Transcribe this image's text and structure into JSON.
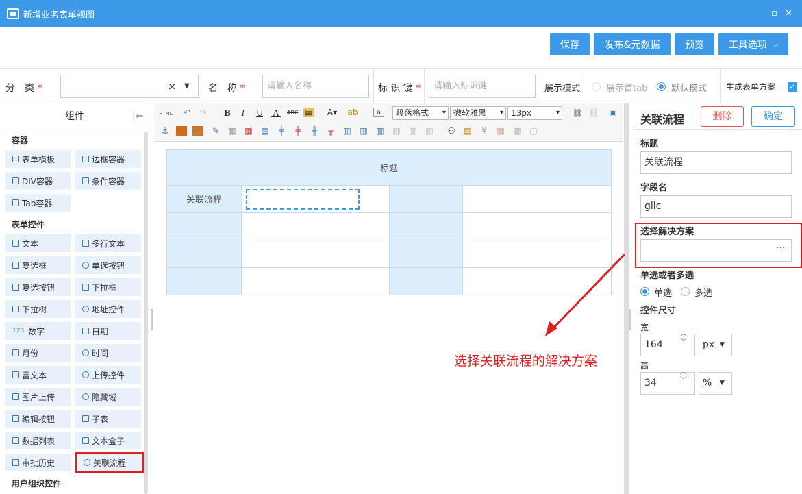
{
  "window": {
    "title": "新增业务表单视图",
    "restore": "▫",
    "close": "✕"
  },
  "toolbar": {
    "save": "保存",
    "publish": "发布&元数据",
    "preview": "预览",
    "tools": "工具选项"
  },
  "form": {
    "category_label": "分　类",
    "category_clear": "×",
    "required": "*",
    "name_label": "名　称",
    "name_placeholder": "请输入名称",
    "key_label": "标 识 键",
    "key_placeholder": "请输入标识键",
    "display_label": "展示模式",
    "display_first_tab": "展示首tab",
    "display_default": "默认模式",
    "generate_label": "生成表单方案"
  },
  "components": {
    "header": "组件",
    "sections": [
      "容器",
      "表单控件",
      "用户组织控件"
    ],
    "container_items": [
      "表单模板",
      "边框容器",
      "DIV容器",
      "条件容器",
      "Tab容器"
    ],
    "control_items": [
      "文本",
      "多行文本",
      "复选框",
      "单选按钮",
      "复选按钮",
      "下拉框",
      "下拉树",
      "地址控件",
      "数字",
      "日期",
      "月份",
      "时间",
      "富文本",
      "上传控件",
      "图片上传",
      "隐藏域",
      "编辑按钮",
      "子表",
      "数据列表",
      "文本盒子",
      "审批历史",
      "关联流程"
    ],
    "number_prefix": "123"
  },
  "editor": {
    "html_label": "HTML",
    "para_format": "段落格式",
    "font_family": "微软雅黑",
    "font_size": "13px",
    "table_title": "标题",
    "row1_label": "关联流程"
  },
  "properties": {
    "title": "关联流程",
    "delete": "删除",
    "confirm": "确定",
    "title_label": "标题",
    "title_value": "关联流程",
    "field_label": "字段名",
    "field_value": "gllc",
    "solution_label": "选择解决方案",
    "solution_value": "",
    "mode_label": "单选或者多选",
    "mode_single": "单选",
    "mode_multi": "多选",
    "size_label": "控件尺寸",
    "width_label": "宽",
    "width_value": "164",
    "width_unit": "px",
    "height_label": "高",
    "height_value": "34",
    "height_unit": "%"
  },
  "annotation": "选择关联流程的解决方案",
  "colors": {
    "accent": "#3c99e8",
    "annotation": "#e02020",
    "delete": "#e55353"
  }
}
